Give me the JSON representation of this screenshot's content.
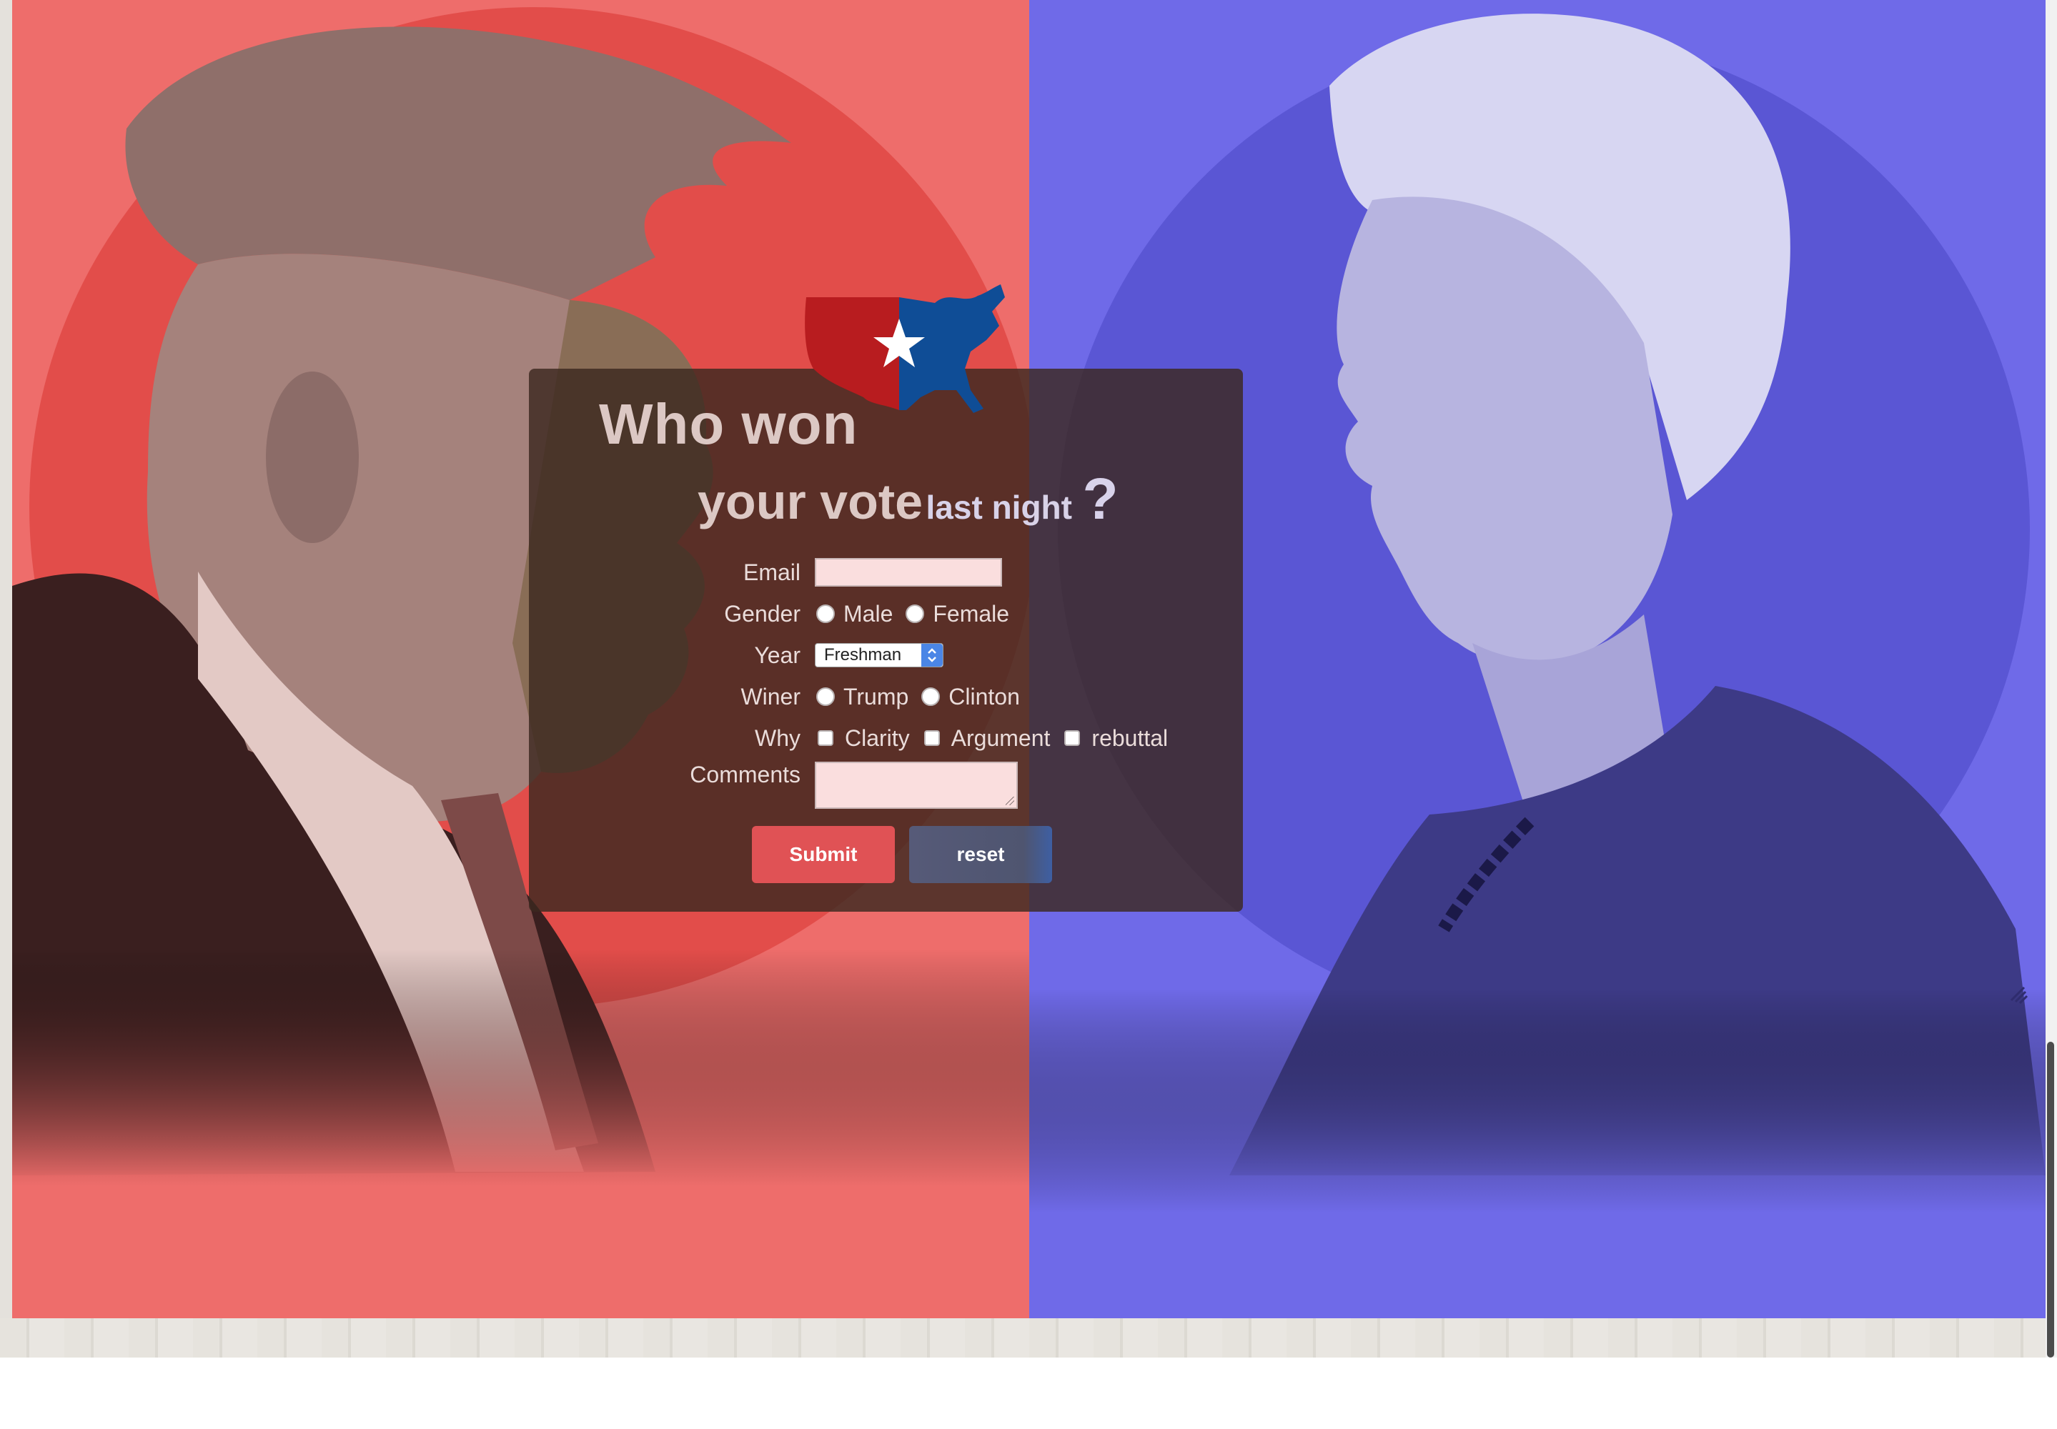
{
  "header": {
    "title_line1": "Who won",
    "title_line2_main": "your vote",
    "title_line2_small": "last night",
    "title_question": "?"
  },
  "form": {
    "email": {
      "label": "Email",
      "value": ""
    },
    "gender": {
      "label": "Gender",
      "options": [
        "Male",
        "Female"
      ]
    },
    "year": {
      "label": "Year",
      "selected": "Freshman"
    },
    "winner": {
      "label": "Winer",
      "options": [
        "Trump",
        "Clinton"
      ]
    },
    "why": {
      "label": "Why",
      "options": [
        "Clarity",
        "Argument",
        "rebuttal"
      ]
    },
    "comments": {
      "label": "Comments",
      "value": ""
    },
    "submit_label": "Submit",
    "reset_label": "reset"
  },
  "theme": {
    "left_color": "#ee6d6b",
    "right_color": "#6f6ae8",
    "submit_color": "#e05255",
    "reset_color": "#565a78"
  },
  "icons": {
    "logo": "us-map-logo",
    "star": "star-icon",
    "select_arrows": "chevron-updown-icon",
    "resize": "resize-handle-icon"
  }
}
